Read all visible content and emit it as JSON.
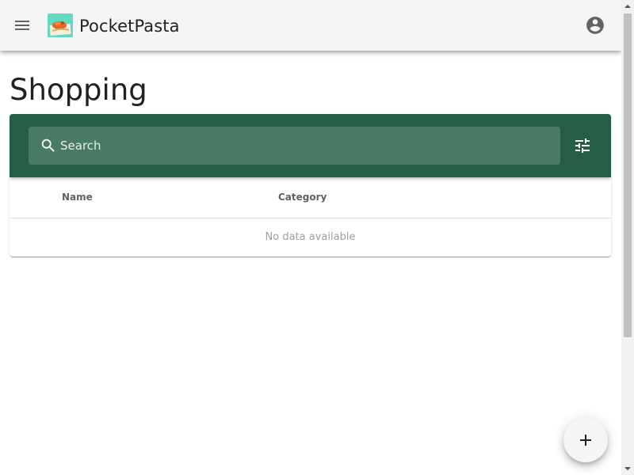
{
  "app_bar": {
    "title": "PocketPasta",
    "menu_icon": "menu-icon",
    "logo_icon": "pasta-logo",
    "account_icon": "account-circle-icon",
    "background": "#f5f5f5"
  },
  "page": {
    "title": "Shopping"
  },
  "toolbar": {
    "background": "#255e44",
    "search": {
      "placeholder": "Search",
      "value": "",
      "icon": "search-icon"
    },
    "filter_icon": "tune-icon"
  },
  "table": {
    "columns": [
      "Name",
      "Category"
    ],
    "rows": [],
    "empty_text": "No data available"
  },
  "fab": {
    "label": "+",
    "icon": "add-icon"
  }
}
